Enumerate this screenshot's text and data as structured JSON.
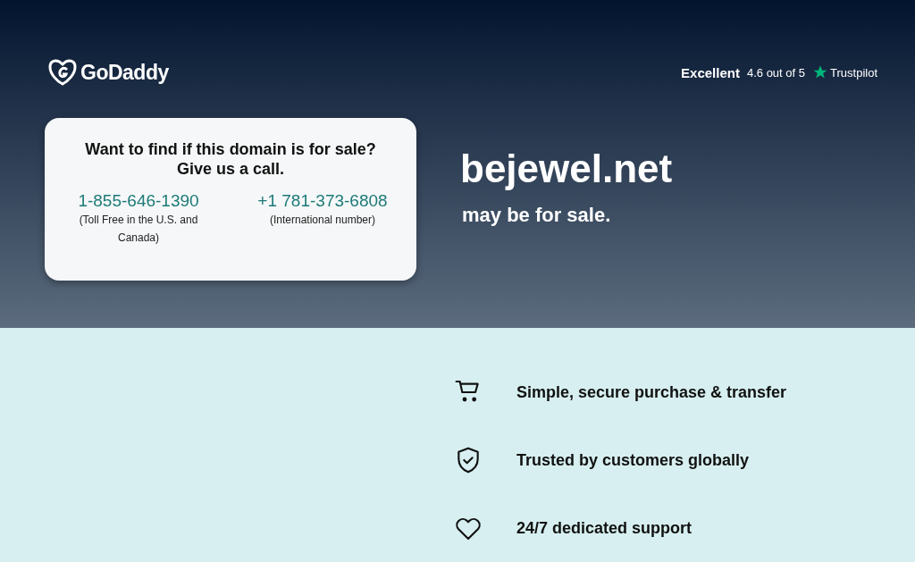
{
  "header": {
    "logo": "GoDaddy",
    "rating": {
      "label": "Excellent",
      "score": "4.6 out of 5",
      "brand": "Trustpilot"
    }
  },
  "call_card": {
    "title": "Want to find if this domain is for sale?",
    "subtitle": "Give us a call.",
    "phones": [
      {
        "number": "1-855-646-1390",
        "note": "(Toll Free in the U.S. and Canada)"
      },
      {
        "number": "+1 781-373-6808",
        "note": "(International number)"
      }
    ]
  },
  "domain": {
    "name": "bejewel.net",
    "status": "may be for sale."
  },
  "features": [
    {
      "kind": "cart",
      "text": "Simple, secure purchase & transfer"
    },
    {
      "kind": "shield",
      "text": "Trusted by customers globally"
    },
    {
      "kind": "heart",
      "text": "24/7 dedicated support"
    }
  ]
}
